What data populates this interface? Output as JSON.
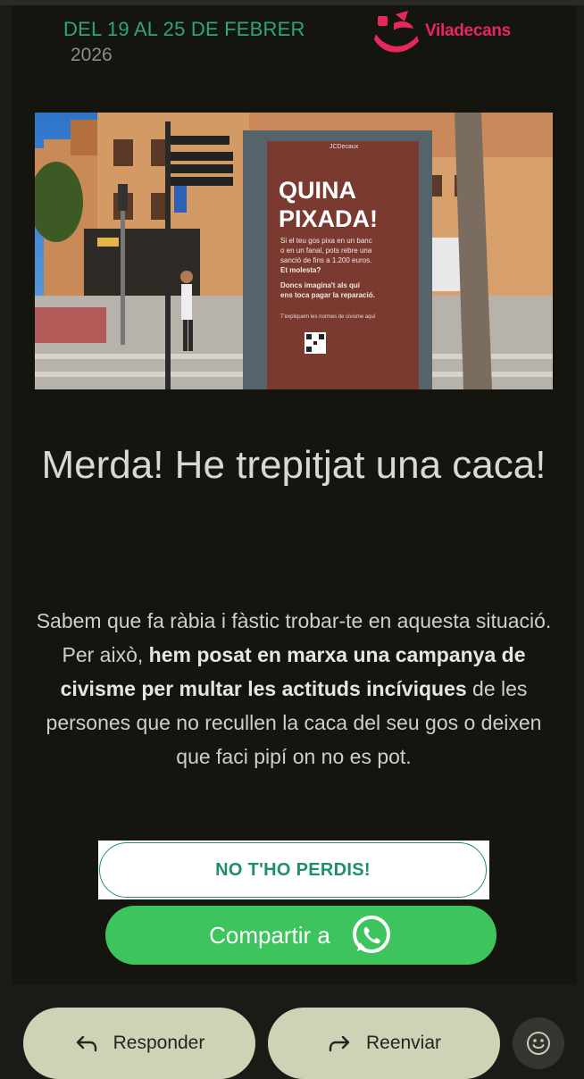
{
  "newsletter": {
    "date_range": "DEL 19 AL 25 DE FEBRER",
    "year": "2026",
    "brand": "Viladecans"
  },
  "hero_poster": {
    "headline": [
      "QUINA",
      "PIXADA!"
    ],
    "body": [
      "Si el teu gos pixa en un banc",
      "o en un fanal, pots rebre una",
      "sanció de fins a 1.200 euros.",
      "Et molesta?"
    ],
    "highlight": [
      "Doncs imagina't als qui",
      "ens toca pagar la reparació."
    ],
    "footer": "T'expliquem les normes de civisme aquí",
    "kiosk_brand": "JCDecaux"
  },
  "article": {
    "headline": "Merda! He trepitjat una caca!",
    "body_intro": "Sabem que fa ràbia i fàstic trobar-te en aquesta situació. Per això, ",
    "body_bold": "hem posat en marxa una campanya de civisme per multar les actituds incíviques",
    "body_outro": " de les persones que no recullen la caca del seu gos o deixen que faci pipí on no es pot."
  },
  "cta": {
    "label": "NO T'HO PERDIS!"
  },
  "share": {
    "label": "Compartir a",
    "icon": "whatsapp-icon",
    "color": "#3ec45d"
  },
  "reply_bar": {
    "reply_label": "Responder",
    "forward_label": "Reenviar",
    "reply_icon": "reply-arrow-icon",
    "forward_icon": "forward-arrow-icon",
    "emoji_icon": "emoji-smile-icon"
  },
  "colors": {
    "accent_green": "#1f8f68",
    "brand_pink": "#e8275f",
    "background": "#14150f",
    "pill": "#cfd3b6"
  }
}
